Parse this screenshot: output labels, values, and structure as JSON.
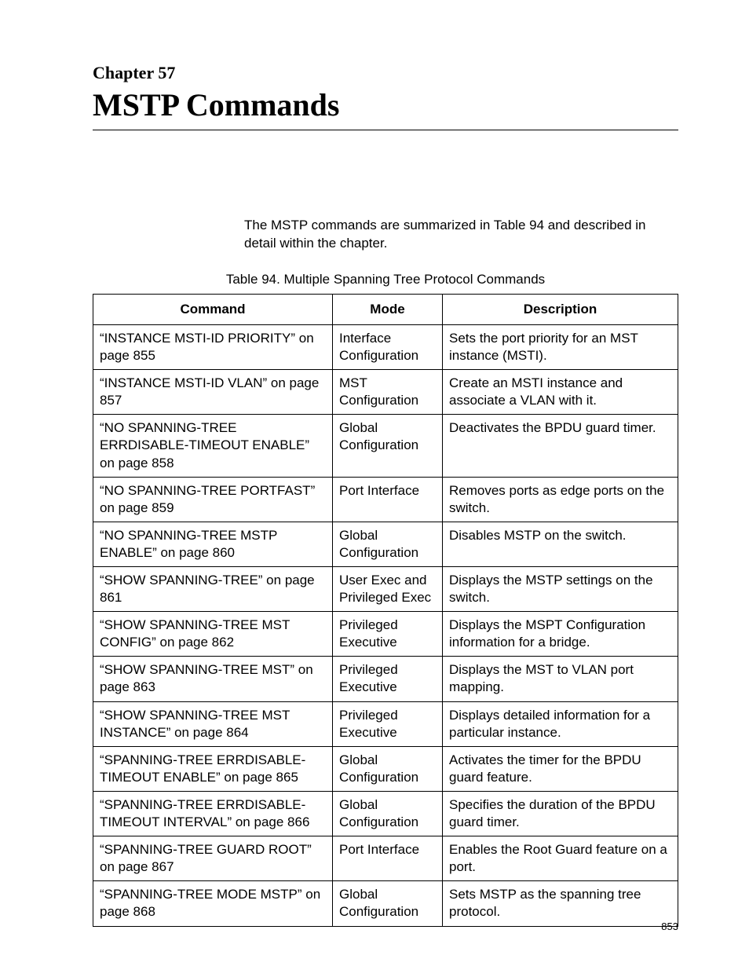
{
  "chapter": {
    "label": "Chapter 57",
    "title": "MSTP Commands"
  },
  "intro": "The MSTP commands are summarized in Table 94 and described in detail within the chapter.",
  "table": {
    "caption": "Table 94. Multiple Spanning Tree Protocol Commands",
    "headers": {
      "command": "Command",
      "mode": "Mode",
      "description": "Description"
    },
    "rows": [
      {
        "command": "“INSTANCE MSTI-ID PRIORITY” on page 855",
        "mode": "Interface Configuration",
        "description": "Sets the port priority for an MST instance (MSTI)."
      },
      {
        "command": "“INSTANCE MSTI-ID VLAN” on page 857",
        "mode": "MST Configuration",
        "description": "Create an MSTI instance and associate a VLAN with it."
      },
      {
        "command": "“NO SPANNING-TREE ERRDISABLE-TIMEOUT ENABLE” on page 858",
        "mode": "Global Configuration",
        "description": "Deactivates the BPDU guard timer."
      },
      {
        "command": "“NO SPANNING-TREE PORTFAST” on page 859",
        "mode": "Port Interface",
        "description": "Removes ports as edge ports on the switch."
      },
      {
        "command": "“NO SPANNING-TREE MSTP ENABLE” on page 860",
        "mode": "Global Configuration",
        "description": "Disables MSTP on the switch."
      },
      {
        "command": "“SHOW SPANNING-TREE” on page 861",
        "mode": "User Exec and Privileged Exec",
        "description": "Displays the MSTP settings on the switch."
      },
      {
        "command": "“SHOW SPANNING-TREE MST CONFIG” on page 862",
        "mode": "Privileged Executive",
        "description": "Displays the MSPT Configuration information for a bridge."
      },
      {
        "command": "“SHOW SPANNING-TREE MST” on page 863",
        "mode": "Privileged Executive",
        "description": "Displays the MST to VLAN port mapping."
      },
      {
        "command": "“SHOW SPANNING-TREE MST INSTANCE” on page 864",
        "mode": "Privileged Executive",
        "description": "Displays detailed information for a particular instance."
      },
      {
        "command": "“SPANNING-TREE ERRDISABLE-TIMEOUT ENABLE” on page 865",
        "mode": "Global Configuration",
        "description": "Activates the timer for the BPDU guard feature."
      },
      {
        "command": "“SPANNING-TREE ERRDISABLE-TIMEOUT INTERVAL” on page 866",
        "mode": "Global Configuration",
        "description": "Specifies the duration of the BPDU guard timer."
      },
      {
        "command": "“SPANNING-TREE GUARD ROOT” on page 867",
        "mode": "Port Interface",
        "description": "Enables the Root Guard feature on a port."
      },
      {
        "command": "“SPANNING-TREE MODE MSTP” on page 868",
        "mode": "Global Configuration",
        "description": "Sets MSTP as the spanning tree protocol."
      }
    ]
  },
  "page_number": "853"
}
